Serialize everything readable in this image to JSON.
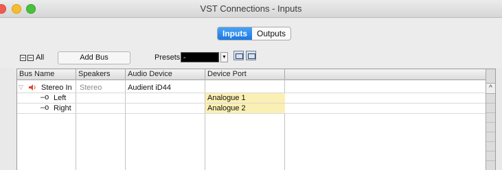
{
  "window": {
    "title": "VST Connections - Inputs"
  },
  "tabs": [
    {
      "label": "Inputs",
      "active": true
    },
    {
      "label": "Outputs",
      "active": false
    }
  ],
  "toolbar": {
    "all_label": "All",
    "add_bus_label": "Add Bus",
    "presets_label": "Presets",
    "presets_value": "-"
  },
  "table": {
    "columns": [
      "Bus Name",
      "Speakers",
      "Audio Device",
      "Device Port"
    ],
    "rows": [
      {
        "bus_name": "Stereo In",
        "speakers": "Stereo",
        "audio_device": "Audient iD44",
        "device_port": "",
        "level": 0,
        "expanded": true
      },
      {
        "bus_name": "Left",
        "speakers": "",
        "audio_device": "",
        "device_port": "Analogue 1",
        "level": 1
      },
      {
        "bus_name": "Right",
        "speakers": "",
        "audio_device": "",
        "device_port": "Analogue 2",
        "level": 1
      }
    ]
  },
  "colors": {
    "accent": "#1b78e4",
    "port_highlight": "#fbf0b3"
  }
}
